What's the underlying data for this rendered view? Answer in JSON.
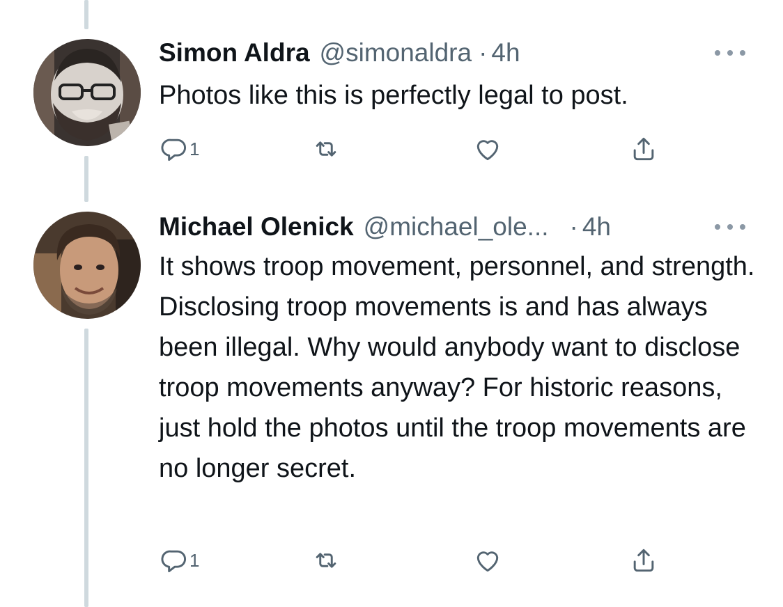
{
  "tweets": [
    {
      "name": "Simon Aldra",
      "handle": "@simonaldra",
      "sep": "·",
      "time": "4h",
      "text": "Photos like this is perfectly legal to post.",
      "reply_count": "1"
    },
    {
      "name": "Michael Olenick",
      "handle": "@michael_ole...",
      "sep": "·",
      "time": "4h",
      "text": "It shows troop movement, personnel, and strength. Disclosing troop movements is and has always been illegal. Why would anybody want to disclose troop movements anyway? For historic reasons, just hold the photos until the troop movements are no longer secret.",
      "reply_count": "1"
    }
  ],
  "icons": {
    "reply": "reply-icon",
    "retweet": "retweet-icon",
    "like": "heart-icon",
    "share": "share-icon",
    "more": "more-icon"
  },
  "colors": {
    "text": "#0f1419",
    "secondary": "#536471",
    "icon": "#536471",
    "thread_line": "#cfd9de"
  }
}
